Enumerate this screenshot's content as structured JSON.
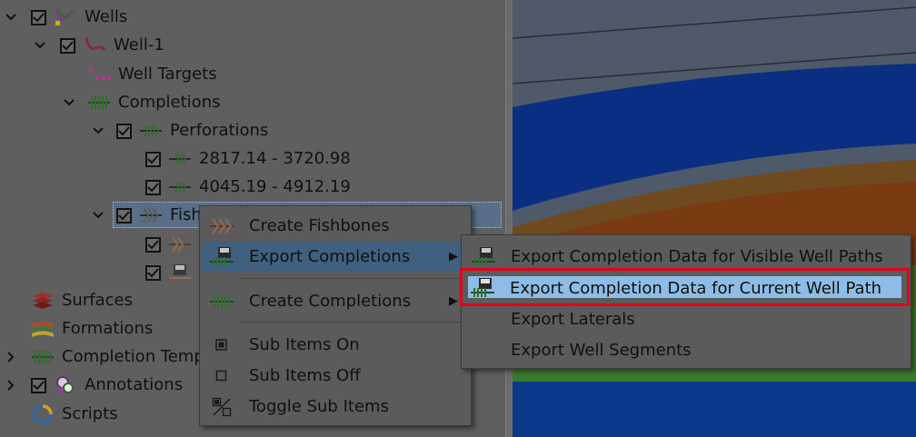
{
  "tree": {
    "wells": "Wells",
    "well1": "Well-1",
    "well_targets": "Well Targets",
    "completions": "Completions",
    "perforations": "Perforations",
    "perf1": "2817.14 - 3720.98",
    "perf2": "4045.19 - 4912.19",
    "fishbones": "Fish",
    "surfaces": "Surfaces",
    "formations": "Formations",
    "completion_templates": "Completion Temp",
    "annotations": "Annotations",
    "scripts": "Scripts"
  },
  "context_menu": {
    "create_fishbones": "Create Fishbones",
    "export_completions": "Export Completions",
    "create_completions": "Create Completions",
    "sub_items_on": "Sub Items On",
    "sub_items_off": "Sub Items Off",
    "toggle_sub_items": "Toggle Sub Items"
  },
  "submenu": {
    "visible": "Export Completion Data for Visible Well Paths",
    "current": "Export Completion Data for Current Well Path",
    "laterals": "Export Laterals",
    "segments": "Export Well Segments"
  },
  "colors": {
    "highlight_border": "#e3001b",
    "selection": "#8dbde6"
  }
}
